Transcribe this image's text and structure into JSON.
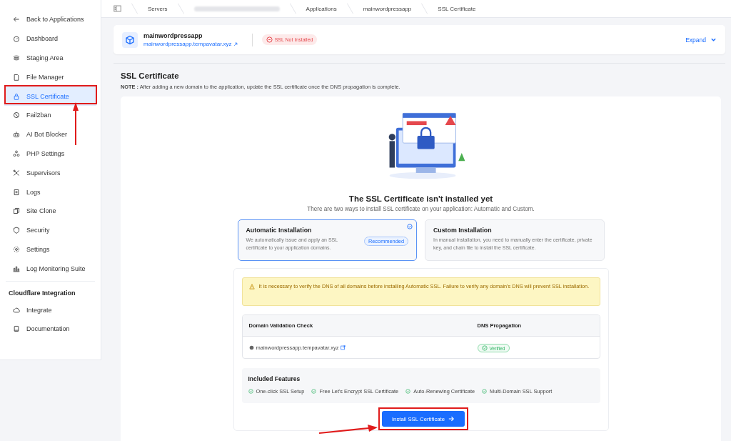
{
  "sidebar": {
    "back": "Back to Applications",
    "items": [
      {
        "label": "Dashboard",
        "selected": false
      },
      {
        "label": "Staging Area",
        "selected": false
      },
      {
        "label": "File Manager",
        "selected": false
      },
      {
        "label": "SSL Certificate",
        "selected": true
      },
      {
        "label": "Fail2ban",
        "selected": false
      },
      {
        "label": "AI Bot Blocker",
        "selected": false
      },
      {
        "label": "PHP Settings",
        "selected": false
      },
      {
        "label": "Supervisors",
        "selected": false
      },
      {
        "label": "Logs",
        "selected": false
      },
      {
        "label": "Site Clone",
        "selected": false
      },
      {
        "label": "Security",
        "selected": false
      },
      {
        "label": "Settings",
        "selected": false
      },
      {
        "label": "Log Monitoring Suite",
        "selected": false
      }
    ],
    "section_title": "Cloudflare Integration",
    "section_items": [
      {
        "label": "Integrate",
        "selected": false
      },
      {
        "label": "Documentation",
        "selected": false
      }
    ]
  },
  "breadcrumb": [
    {
      "kind": "text",
      "label": "Servers"
    },
    {
      "kind": "blurred"
    },
    {
      "kind": "text",
      "label": "Applications"
    },
    {
      "kind": "text",
      "label": "mainwordpressapp"
    },
    {
      "kind": "text",
      "label": "SSL Certificate"
    }
  ],
  "app": {
    "name": "mainwordpressapp",
    "url": "mainwordpressapp.tempavatar.xyz",
    "status": "SSL Not Installed",
    "expand": "Expand"
  },
  "page": {
    "title": "SSL Certificate",
    "note": "**NOTE :** After adding a new domain to the application, update the SSL certificate once the DNS propagation is complete."
  },
  "panel": {
    "heading": "The SSL Certificate isn't installed yet",
    "subheading": "There are two ways to install SSL certificate on your application: Automatic and Custom.",
    "options": [
      {
        "title": "Automatic Installation",
        "description": "We automatically issue and apply an SSL certificate to your application domains.",
        "badge": "Recommended",
        "selected": true
      },
      {
        "title": "Custom Installation",
        "description": "In manual installation, you need to manually enter the certificate, private key, and chain file to install the SSL certificate.",
        "selected": false
      }
    ],
    "warning": "It is necessary to verify the DNS of all domains before installing Automatic SSL. Failure to verify any domain's DNS will prevent SSL installation.",
    "table": {
      "columns": [
        "Domain Validation Check",
        "DNS Propagation"
      ],
      "rows": [
        {
          "domain": "mainwordpressapp.tempavatar.xyz",
          "status": "Verified"
        }
      ]
    },
    "features": {
      "title": "Included Features",
      "items": [
        "One-click SSL Setup",
        "Free Let's Encrypt SSL Certificate",
        "Auto-Renewing Certificate",
        "Multi-Domain SSL Support"
      ]
    },
    "button": "Install SSL Certificate"
  }
}
